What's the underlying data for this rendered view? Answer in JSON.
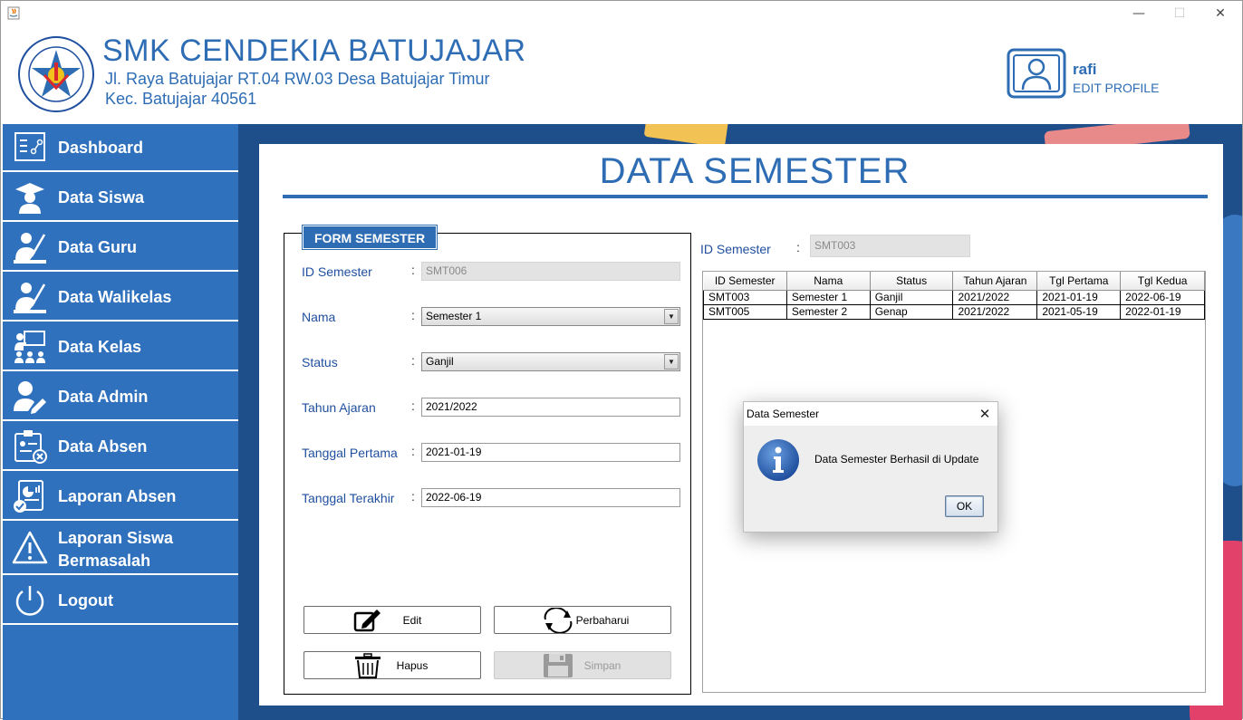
{
  "window": {
    "minimize": "—",
    "maximize": "☐",
    "close": "✕"
  },
  "header": {
    "school_name": "SMK CENDEKIA BATUJAJAR",
    "address_line1": "Jl. Raya Batujajar RT.04 RW.03 Desa Batujajar Timur",
    "address_line2": "Kec. Batujajar 40561",
    "user_name": "rafi",
    "edit_profile": "EDIT PROFILE",
    "logo_text_top": "SMK CENDEKIA BATUJAJAR",
    "logo_text_bottom": "YAYASAN PUTRA CENDEKIA"
  },
  "sidebar": {
    "items": [
      {
        "label": "Dashboard",
        "icon": "dashboard-icon"
      },
      {
        "label": "Data Siswa",
        "icon": "student-icon"
      },
      {
        "label": "Data Guru",
        "icon": "teacher-icon"
      },
      {
        "label": "Data Walikelas",
        "icon": "homeroom-teacher-icon"
      },
      {
        "label": "Data Kelas",
        "icon": "classroom-icon"
      },
      {
        "label": "Data Admin",
        "icon": "admin-icon"
      },
      {
        "label": "Data Absen",
        "icon": "attendance-icon"
      },
      {
        "label": "Laporan Absen",
        "icon": "report-icon"
      },
      {
        "label_line1": "Laporan Siswa",
        "label_line2": "Bermasalah",
        "icon": "warning-icon"
      },
      {
        "label": "Logout",
        "icon": "power-icon"
      }
    ]
  },
  "page": {
    "title": "DATA SEMESTER"
  },
  "form": {
    "legend": "FORM SEMESTER",
    "colon": ":",
    "id_label": "ID Semester",
    "id_value": "SMT006",
    "nama_label": "Nama",
    "nama_value": "Semester 1",
    "status_label": "Status",
    "status_value": "Ganjil",
    "tahun_label": "Tahun Ajaran",
    "tahun_value": "2021/2022",
    "tgl1_label": "Tanggal Pertama",
    "tgl1_value": "2021-01-19",
    "tgl2_label": "Tanggal Terakhir",
    "tgl2_value": "2022-06-19",
    "buttons": {
      "edit": "Edit",
      "refresh": "Perbaharui",
      "delete": "Hapus",
      "save": "Simpan"
    }
  },
  "right": {
    "id_label": "ID Semester",
    "colon": ":",
    "id_value": "SMT003"
  },
  "table": {
    "headers": [
      "ID Semester",
      "Nama",
      "Status",
      "Tahun Ajaran",
      "Tgl Pertama",
      "Tgl Kedua"
    ],
    "rows": [
      [
        "SMT003",
        "Semester 1",
        "Ganjil",
        "2021/2022",
        "2021-01-19",
        "2022-06-19"
      ],
      [
        "SMT005",
        "Semester 2",
        "Genap",
        "2021/2022",
        "2021-05-19",
        "2022-01-19"
      ]
    ]
  },
  "dialog": {
    "title": "Data Semester",
    "close": "✕",
    "message": "Data Semester Berhasil di Update",
    "ok": "OK",
    "icon": "info-icon"
  },
  "colors": {
    "primary": "#2e6db4",
    "sidebar": "#2f71bd",
    "label": "#1f4f9e"
  }
}
